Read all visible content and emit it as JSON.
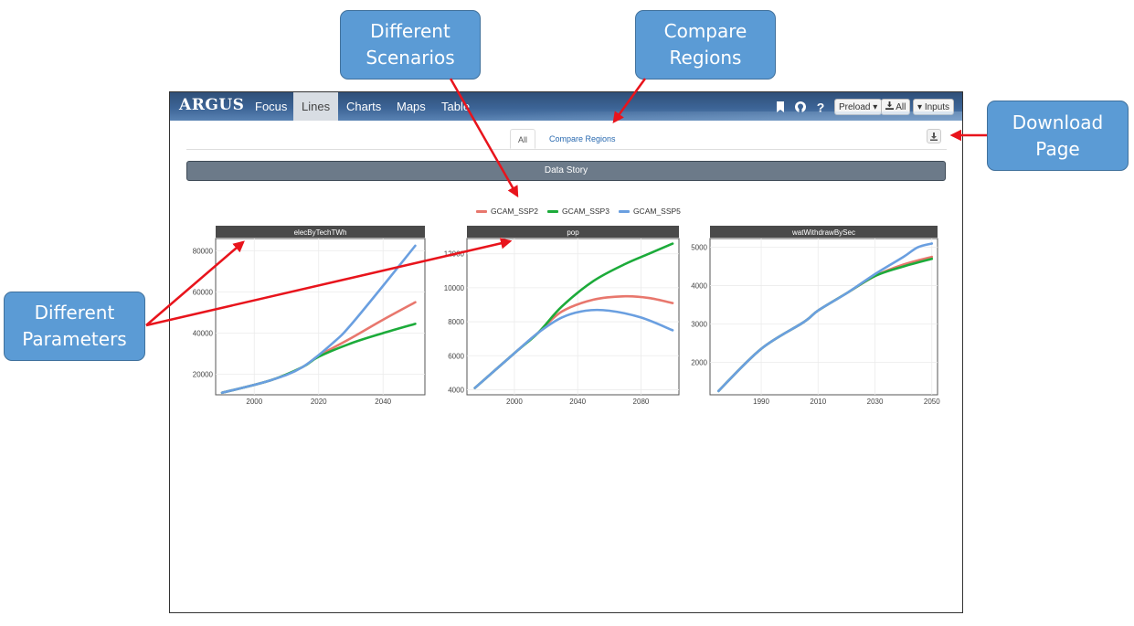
{
  "callouts": {
    "scenarios": "Different\nScenarios",
    "regions": "Compare\nRegions",
    "download": "Download\nPage",
    "parameters": "Different\nParameters"
  },
  "navbar": {
    "brand": "ARGUS",
    "items": [
      "Focus",
      "Lines",
      "Charts",
      "Maps",
      "Table"
    ],
    "active": "Lines",
    "preload_label": "Preload",
    "all_label": "All",
    "inputs_label": "Inputs"
  },
  "tabs": {
    "all": "All",
    "compare": "Compare Regions"
  },
  "data_story": "Data Story",
  "colors": {
    "GCAM_SSP2": "#e8776d",
    "GCAM_SSP3": "#1cab3a",
    "GCAM_SSP5": "#6a9fe0",
    "navbar": "#3c6496",
    "callout": "#5b9bd5",
    "arrow": "#e8141c"
  },
  "chart_data": [
    {
      "type": "line",
      "title": "elecByTechTWh",
      "xlim": [
        1988,
        2053
      ],
      "ylim": [
        10000,
        86000
      ],
      "xticks": [
        2000,
        2020,
        2040
      ],
      "yticks": [
        20000,
        40000,
        60000,
        80000
      ],
      "series": [
        {
          "name": "GCAM_SSP2",
          "x": [
            1990,
            2005,
            2015,
            2020,
            2030,
            2040,
            2050
          ],
          "y": [
            11000,
            17000,
            23500,
            29000,
            37500,
            46500,
            55000
          ]
        },
        {
          "name": "GCAM_SSP3",
          "x": [
            1990,
            2005,
            2015,
            2020,
            2030,
            2040,
            2050
          ],
          "y": [
            11000,
            17000,
            23500,
            28500,
            35000,
            40000,
            44500
          ]
        },
        {
          "name": "GCAM_SSP5",
          "x": [
            1990,
            2005,
            2015,
            2025,
            2030,
            2040,
            2050
          ],
          "y": [
            11000,
            17000,
            23500,
            36000,
            44000,
            63000,
            82500
          ]
        }
      ]
    },
    {
      "type": "line",
      "title": "pop",
      "xlim": [
        1970,
        2104
      ],
      "ylim": [
        3700,
        12900
      ],
      "xticks": [
        2000,
        2040,
        2080
      ],
      "yticks": [
        4000,
        6000,
        8000,
        10000,
        12000
      ],
      "series": [
        {
          "name": "GCAM_SSP2",
          "x": [
            1975,
            2000,
            2015,
            2030,
            2050,
            2070,
            2085,
            2100
          ],
          "y": [
            4100,
            6150,
            7350,
            8600,
            9300,
            9500,
            9400,
            9100
          ]
        },
        {
          "name": "GCAM_SSP3",
          "x": [
            1975,
            2000,
            2015,
            2030,
            2050,
            2070,
            2085,
            2100
          ],
          "y": [
            4100,
            6150,
            7350,
            8900,
            10400,
            11400,
            12000,
            12600
          ]
        },
        {
          "name": "GCAM_SSP5",
          "x": [
            1975,
            2000,
            2015,
            2030,
            2045,
            2060,
            2080,
            2100
          ],
          "y": [
            4100,
            6150,
            7350,
            8250,
            8650,
            8650,
            8250,
            7500
          ]
        }
      ]
    },
    {
      "type": "line",
      "title": "watWithdrawBySec",
      "xlim": [
        1972,
        2052
      ],
      "ylim": [
        1150,
        5230
      ],
      "xticks": [
        1990,
        2010,
        2030,
        2050
      ],
      "yticks": [
        2000,
        3000,
        4000,
        5000
      ],
      "series": [
        {
          "name": "GCAM_SSP2",
          "x": [
            1975,
            1990,
            2005,
            2010,
            2020,
            2030,
            2040,
            2050
          ],
          "y": [
            1250,
            2350,
            3050,
            3350,
            3800,
            4250,
            4550,
            4750
          ]
        },
        {
          "name": "GCAM_SSP3",
          "x": [
            1975,
            1990,
            2005,
            2010,
            2020,
            2030,
            2040,
            2050
          ],
          "y": [
            1250,
            2350,
            3050,
            3350,
            3800,
            4250,
            4500,
            4700
          ]
        },
        {
          "name": "GCAM_SSP5",
          "x": [
            1975,
            1990,
            2005,
            2010,
            2020,
            2030,
            2040,
            2045,
            2050
          ],
          "y": [
            1250,
            2350,
            3050,
            3350,
            3800,
            4300,
            4750,
            5000,
            5100
          ]
        }
      ]
    }
  ]
}
